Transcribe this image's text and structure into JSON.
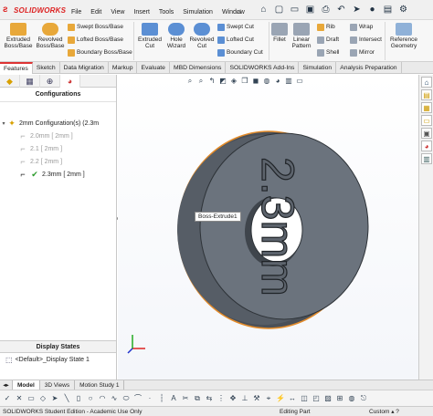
{
  "app": {
    "logo_text": "SOLIDWORKS",
    "menu": [
      "File",
      "Edit",
      "View",
      "Insert",
      "Tools",
      "Simulation",
      "Window"
    ]
  },
  "ribbon": {
    "extruded_boss": "Extruded Boss/Base",
    "revolved_boss": "Revolved Boss/Base",
    "swept_boss": "Swept Boss/Base",
    "lofted_boss": "Lofted Boss/Base",
    "boundary_boss": "Boundary Boss/Base",
    "extruded_cut": "Extruded Cut",
    "hole_wizard": "Hole Wizard",
    "revolved_cut": "Revolved Cut",
    "swept_cut": "Swept Cut",
    "lofted_cut": "Lofted Cut",
    "boundary_cut": "Boundary Cut",
    "fillet": "Fillet",
    "linear_pattern": "Linear Pattern",
    "rib": "Rib",
    "draft": "Draft",
    "shell": "Shell",
    "wrap": "Wrap",
    "intersect": "Intersect",
    "mirror": "Mirror",
    "reference_geometry": "Reference Geometry"
  },
  "tabs": [
    "Features",
    "Sketch",
    "Data Migration",
    "Markup",
    "Evaluate",
    "MBD Dimensions",
    "SOLIDWORKS Add-Ins",
    "Simulation",
    "Analysis Preparation"
  ],
  "panel": {
    "header": "Configurations",
    "root": "2mm Configuration(s)  (2.3m",
    "items": [
      {
        "label": "2.0mm [ 2mm ]"
      },
      {
        "label": "2.1 [ 2mm ]"
      },
      {
        "label": "2.2 [ 2mm ]"
      },
      {
        "label": "2.3mm [ 2mm ]"
      }
    ],
    "display_states_header": "Display States",
    "display_state": "<Default>_Display State 1"
  },
  "viewport": {
    "tooltip": "Boss-Extrude1",
    "part_text": "2.3mm",
    "colors": {
      "part": "#5d646d",
      "rim_highlight": "#e28b2a",
      "face": "#6b737d"
    }
  },
  "bottom_tabs": [
    "Model",
    "3D Views",
    "Motion Study 1"
  ],
  "status": {
    "left": "SOLIDWORKS Student Edition - Academic Use Only",
    "mid": "Editing Part",
    "right": "Custom"
  }
}
